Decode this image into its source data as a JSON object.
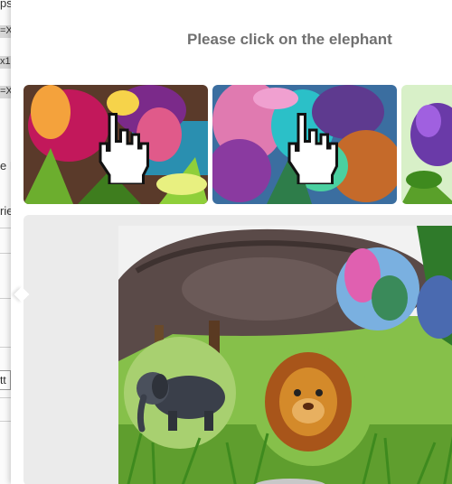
{
  "background_page": {
    "fragments": [
      "ps",
      "=X",
      "x1",
      "=X",
      "e F",
      "rie",
      "tt"
    ]
  },
  "captcha": {
    "prompt": "Please click on the elephant",
    "example_tiles": [
      {
        "name": "example-tile-1",
        "icon": "pointer-hand-icon"
      },
      {
        "name": "example-tile-2",
        "icon": "pointer-hand-icon"
      },
      {
        "name": "example-tile-3"
      }
    ],
    "challenge": {
      "objects": [
        "elephant",
        "lion"
      ]
    }
  },
  "colors": {
    "title": "#707070",
    "stage_bg": "#ebebeb",
    "popup_bg": "#ffffff"
  }
}
